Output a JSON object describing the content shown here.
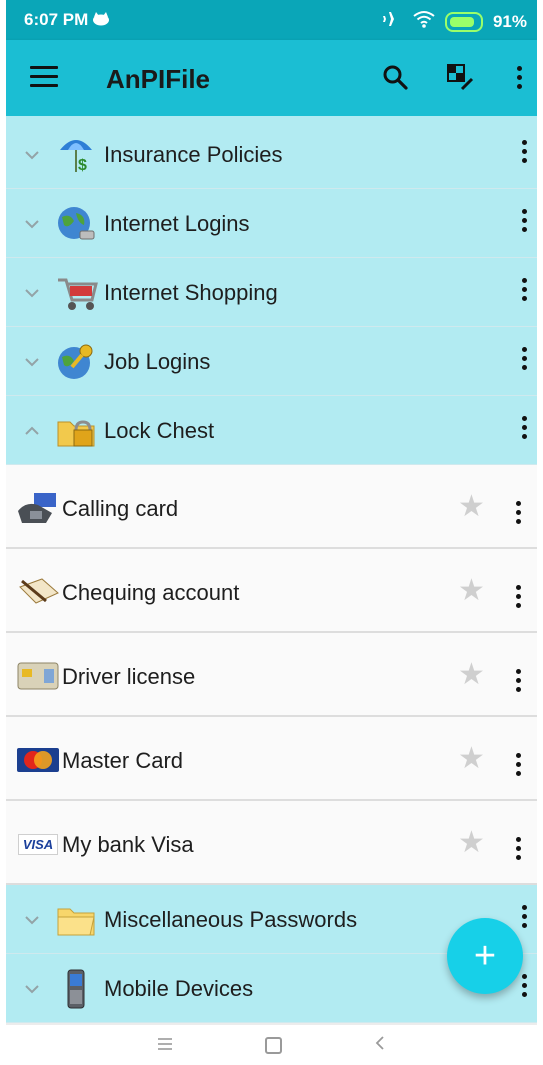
{
  "status_bar": {
    "time": "6:07 PM",
    "battery": "91%",
    "icons": [
      "cat-icon",
      "airplane-mode-icon",
      "wifi-icon",
      "battery-charging-icon"
    ]
  },
  "app_bar": {
    "title": "AnPIFile",
    "icons": [
      "menu-icon",
      "search-icon",
      "edit-grid-icon",
      "more-vert-icon"
    ]
  },
  "colors": {
    "status_bar": "#0aa6b8",
    "app_bar": "#1bbed3",
    "group_row": "#b2ebf2",
    "item_row": "#fafafa",
    "fab": "#17d0e8"
  },
  "groups_before": [
    {
      "label": "Insurance Policies",
      "icon": "umbrella-money-icon",
      "expanded": false
    },
    {
      "label": "Internet Logins",
      "icon": "globe-login-icon",
      "expanded": false
    },
    {
      "label": "Internet Shopping",
      "icon": "shopping-cart-icon",
      "expanded": false
    },
    {
      "label": "Job Logins",
      "icon": "globe-key-icon",
      "expanded": false
    },
    {
      "label": "Lock Chest",
      "icon": "lock-folder-icon",
      "expanded": true
    }
  ],
  "items": [
    {
      "label": "Calling card",
      "icon": "phone-card-icon"
    },
    {
      "label": "Chequing account",
      "icon": "cheque-pen-icon"
    },
    {
      "label": "Driver license",
      "icon": "id-card-icon"
    },
    {
      "label": "Master Card",
      "icon": "mastercard-icon"
    },
    {
      "label": "My bank Visa",
      "icon": "visa-icon",
      "brand_text": "VISA"
    }
  ],
  "groups_after": [
    {
      "label": "Miscellaneous Passwords",
      "icon": "folder-icon",
      "expanded": false
    },
    {
      "label": "Mobile Devices",
      "icon": "mobile-phone-icon",
      "expanded": false
    }
  ],
  "fab": {
    "label": "+"
  },
  "nav_bar": {
    "icons": [
      "recents-icon",
      "home-icon",
      "back-icon"
    ]
  }
}
